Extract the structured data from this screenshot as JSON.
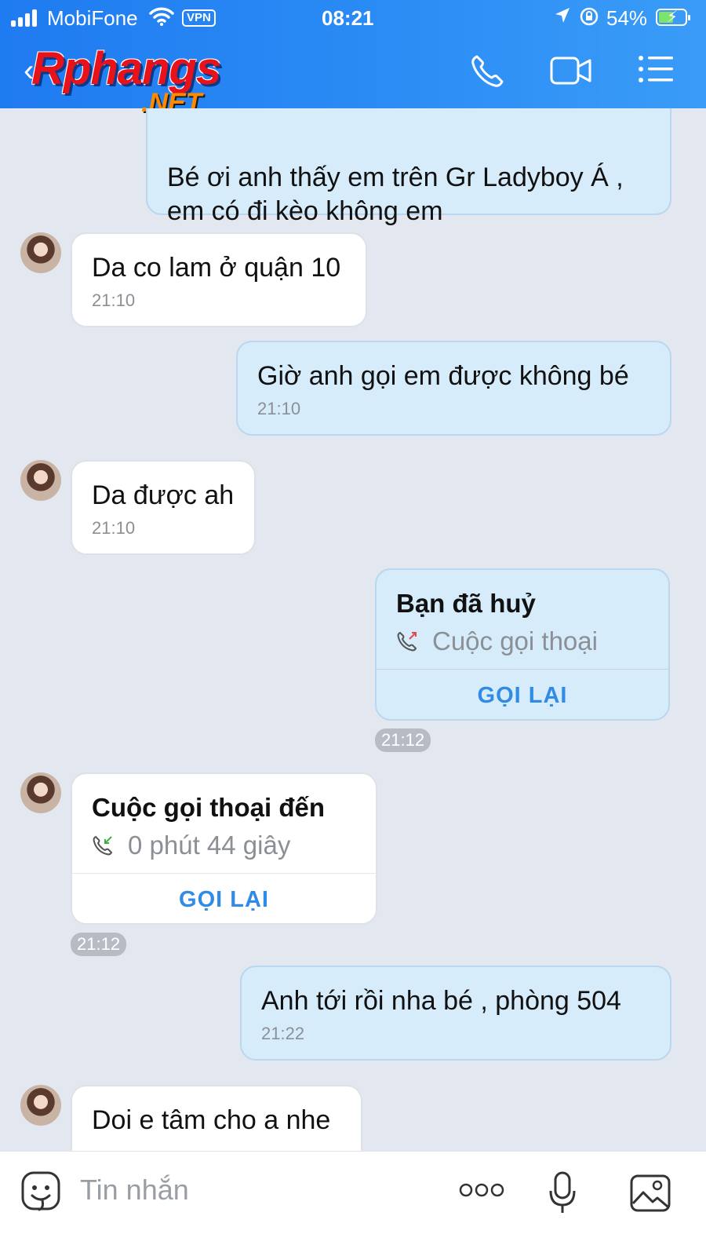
{
  "status_bar": {
    "carrier": "MobiFone",
    "vpn": "VPN",
    "time": "08:21",
    "battery": "54%"
  },
  "header": {
    "logo_text": "Rphangs",
    "logo_suffix": ".NET",
    "icons": [
      "phone-icon",
      "video-call-icon",
      "menu-icon"
    ]
  },
  "messages": [
    {
      "side": "mine",
      "text": "Bé ơi anh thấy em trên Gr Ladyboy Á ,\nem có đi kèo không em"
    },
    {
      "side": "theirs",
      "text": "Da co lam ở quận 10",
      "time": "21:10"
    },
    {
      "side": "mine",
      "text": "Giờ anh gọi em được không bé",
      "time": "21:10"
    },
    {
      "side": "theirs",
      "text": "Da được ah",
      "time": "21:10"
    },
    {
      "side": "mine",
      "type": "call",
      "title": "Bạn đã huỷ",
      "subtitle": "Cuộc gọi thoại",
      "action": "GỌI LẠI",
      "time": "21:12"
    },
    {
      "side": "theirs",
      "type": "call",
      "title": "Cuộc gọi thoại đến",
      "subtitle": "0 phút 44 giây",
      "action": "GỌI LẠI",
      "time": "21:12"
    },
    {
      "side": "mine",
      "text": "Anh tới rồi nha bé , phòng 504",
      "time": "21:22"
    },
    {
      "side": "theirs",
      "text": "Doi e tâm cho a nhe"
    }
  ],
  "input_bar": {
    "placeholder": "Tin nhắn"
  },
  "colors": {
    "header": "#2b8cf5",
    "background": "#e3e7ef",
    "bubble_mine": "#d6ecfb",
    "bubble_theirs": "#ffffff",
    "accent": "#2f8be6"
  }
}
